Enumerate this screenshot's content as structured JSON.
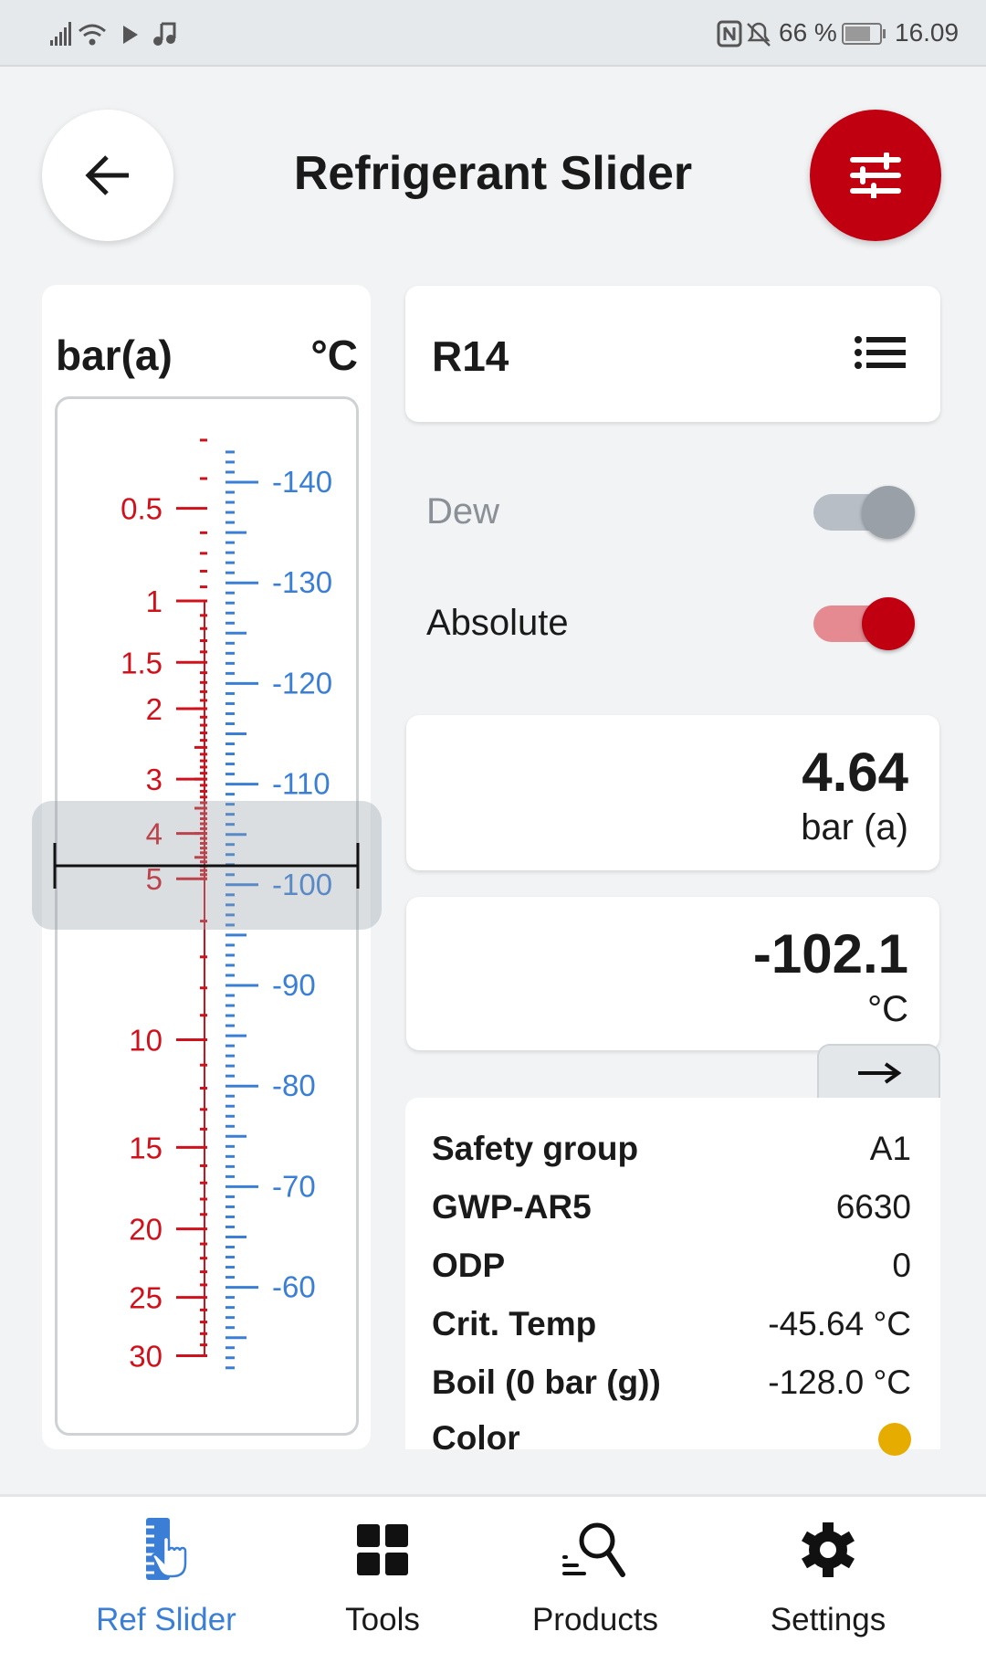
{
  "status_bar": {
    "battery": "66 %",
    "time": "16.09",
    "icons": [
      "signal-icon",
      "wifi-icon",
      "cast-icon",
      "music-icon",
      "nfc-icon",
      "bell-off-icon",
      "battery-icon"
    ]
  },
  "header": {
    "title": "Refrigerant Slider",
    "back_icon": "arrow-left-icon",
    "filter_icon": "sliders-icon"
  },
  "scale": {
    "pressure_unit": "bar(a)",
    "temperature_unit": "°C",
    "pressure_color": "#d0111b",
    "temperature_color": "#3a7fd5",
    "temperature_labels": [
      "-140",
      "-130",
      "-120",
      "-110",
      "-100",
      "-90",
      "-80",
      "-70",
      "-60"
    ],
    "pressure_labels": [
      {
        "label": "0.5",
        "p": 0.5,
        "t": -137.4
      },
      {
        "label": "1",
        "p": 1,
        "t": -128.2
      },
      {
        "label": "1.5",
        "p": 1.5,
        "t": -122.1
      },
      {
        "label": "2",
        "p": 2,
        "t": -117.5
      },
      {
        "label": "3",
        "p": 3,
        "t": -110.5
      },
      {
        "label": "4",
        "p": 4,
        "t": -105.1
      },
      {
        "label": "5",
        "p": 5,
        "t": -100.6
      },
      {
        "label": "10",
        "p": 10,
        "t": -84.6
      },
      {
        "label": "15",
        "p": 15,
        "t": -73.9
      },
      {
        "label": "20",
        "p": 20,
        "t": -65.8
      },
      {
        "label": "25",
        "p": 25,
        "t": -59.0
      },
      {
        "label": "30",
        "p": 30,
        "t": -53.2
      }
    ],
    "temperature_range": [
      -143,
      -52
    ],
    "selected_temperature": -102.1
  },
  "refrigerant": {
    "name": "R14",
    "list_icon": "list-icon"
  },
  "toggles": {
    "dew": {
      "label": "Dew",
      "on": false
    },
    "absolute": {
      "label": "Absolute",
      "on": true
    }
  },
  "pressure": {
    "value": "4.64",
    "unit": "bar (a)"
  },
  "temperature": {
    "value": "-102.1",
    "unit": "°C"
  },
  "swap_icon": "arrow-right-icon",
  "info": [
    {
      "key": "Safety group",
      "value": "A1"
    },
    {
      "key": "GWP-AR5",
      "value": "6630"
    },
    {
      "key": "ODP",
      "value": "0"
    },
    {
      "key": "Crit. Temp",
      "value": "-45.64 °C"
    },
    {
      "key": "Boil (0 bar (g))",
      "value": "-128.0 °C"
    },
    {
      "key": "Color",
      "value": "",
      "color": "#e6ac00"
    }
  ],
  "nav": [
    {
      "label": "Ref Slider",
      "active": true,
      "color": "#3a7fd5"
    },
    {
      "label": "Tools"
    },
    {
      "label": "Products"
    },
    {
      "label": "Settings"
    }
  ]
}
